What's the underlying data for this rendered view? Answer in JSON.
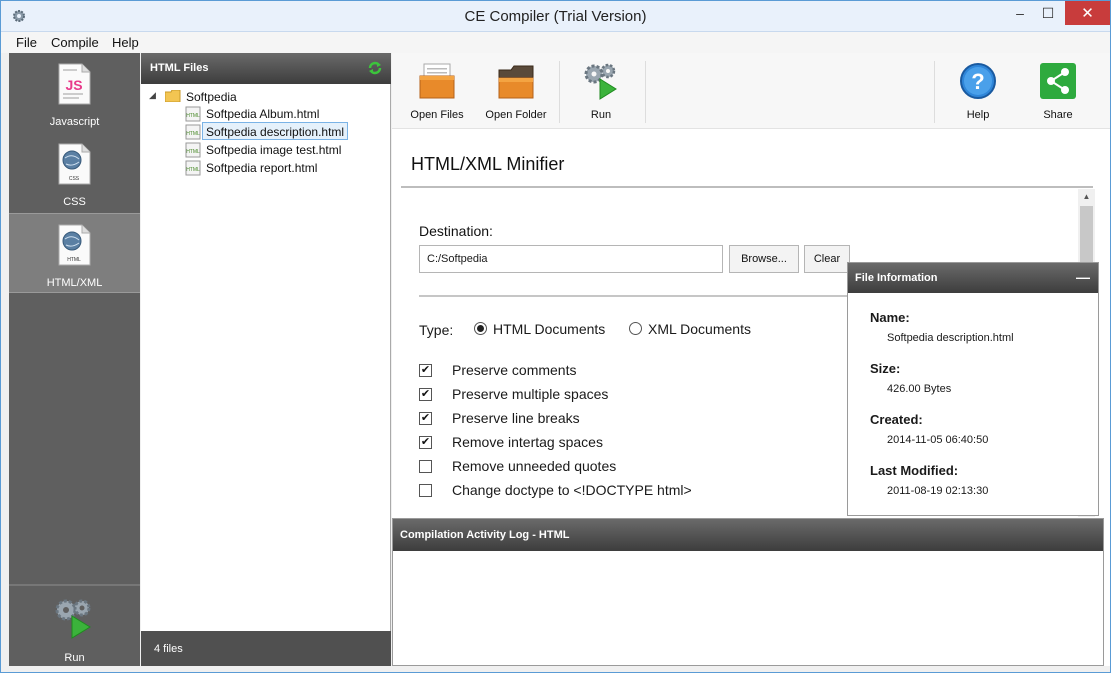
{
  "window": {
    "title": "CE Compiler (Trial Version)",
    "min": "–",
    "max": "☐",
    "close": "✕"
  },
  "menu": [
    "File",
    "Compile",
    "Help"
  ],
  "nav": {
    "javascript": "Javascript",
    "css": "CSS",
    "html": "HTML/XML",
    "run": "Run",
    "js_glyph": "JS",
    "css_glyph": "CSS",
    "html_glyph": "HTML"
  },
  "files": {
    "header": "HTML Files",
    "folder": "Softpedia",
    "items": [
      "Softpedia Album.html",
      "Softpedia description.html",
      "Softpedia image test.html",
      "Softpedia report.html"
    ],
    "file_glyph": "HTML",
    "footer": "4 files"
  },
  "toolbar": {
    "open_files": "Open Files",
    "open_folder": "Open Folder",
    "run": "Run",
    "help": "Help",
    "share": "Share"
  },
  "minifier": {
    "title": "HTML/XML Minifier",
    "destination_label": "Destination:",
    "destination_value": "C:/Softpedia",
    "browse": "Browse...",
    "clear": "Clear",
    "type_label": "Type:",
    "type_html": "HTML Documents",
    "type_xml": "XML Documents",
    "options": [
      {
        "label": "Preserve comments",
        "checked": true
      },
      {
        "label": "Preserve multiple spaces",
        "checked": true
      },
      {
        "label": "Preserve line breaks",
        "checked": true
      },
      {
        "label": "Remove intertag spaces",
        "checked": true
      },
      {
        "label": "Remove unneeded quotes",
        "checked": false
      },
      {
        "label": "Change doctype to <!DOCTYPE html>",
        "checked": false
      }
    ]
  },
  "file_info": {
    "header": "File Information",
    "collapse": "—",
    "name_label": "Name:",
    "name_value": "Softpedia description.html",
    "size_label": "Size:",
    "size_value": "426.00 Bytes",
    "created_label": "Created:",
    "created_value": "2014-11-05 06:40:50",
    "modified_label": "Last Modified:",
    "modified_value": "2011-08-19 02:13:30"
  },
  "log": {
    "header": "Compilation Activity Log - HTML"
  }
}
